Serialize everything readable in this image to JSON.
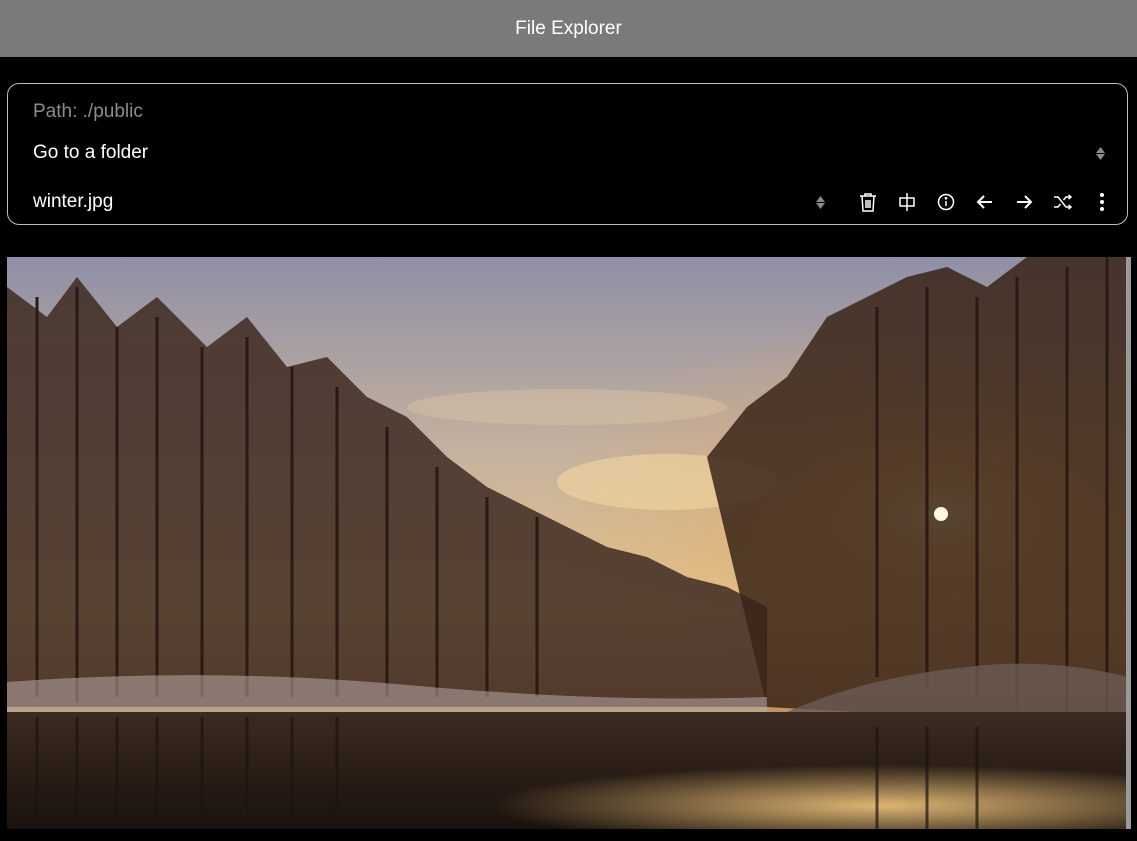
{
  "window": {
    "title": "File Explorer"
  },
  "explorer": {
    "path_label": "Path: ./public",
    "folder_select": {
      "value": "Go to a folder"
    },
    "file_select": {
      "value": "winter.jpg"
    },
    "toolbar": [
      {
        "name": "delete-icon",
        "title": "Delete"
      },
      {
        "name": "resize-icon",
        "title": "Resize"
      },
      {
        "name": "info-icon",
        "title": "Info"
      },
      {
        "name": "arrow-left-icon",
        "title": "Previous"
      },
      {
        "name": "arrow-right-icon",
        "title": "Next"
      },
      {
        "name": "shuffle-icon",
        "title": "Shuffle"
      },
      {
        "name": "more-vertical-icon",
        "title": "More"
      }
    ]
  },
  "preview": {
    "image_description": "Winter sunset over a river with frosted trees and reflections",
    "colors": {
      "sky_top": "#8f8fa6",
      "sky_mid": "#d8b685",
      "sun_glow": "#ffe9a8",
      "trees": "#3a2418",
      "water": "#2a1e16"
    }
  },
  "colors": {
    "titlebar_bg": "#7a7a7a",
    "panel_border": "#bdbdbd",
    "muted_text": "#8c8c8c",
    "background": "#000000"
  }
}
